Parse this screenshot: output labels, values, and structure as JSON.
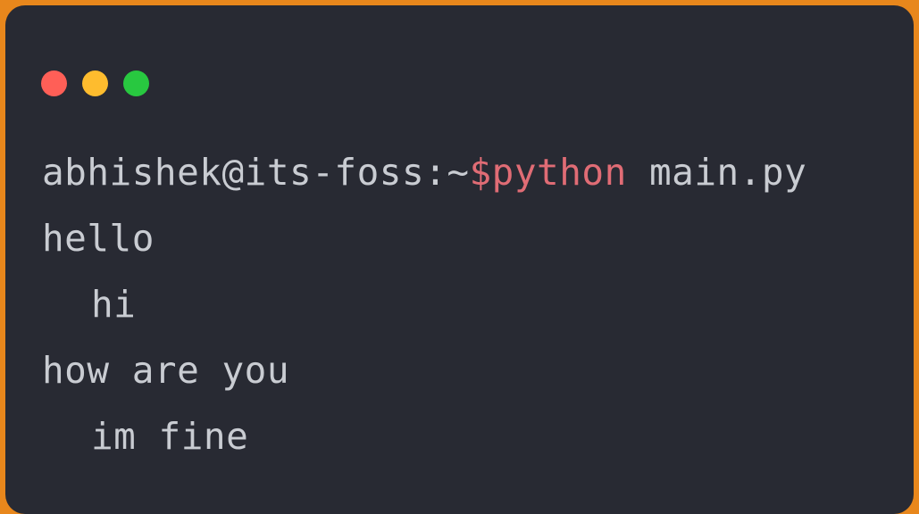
{
  "window": {
    "controls": [
      {
        "name": "close",
        "color": "#ff5f57"
      },
      {
        "name": "minimize",
        "color": "#febc2e"
      },
      {
        "name": "maximize",
        "color": "#28c840"
      }
    ]
  },
  "terminal": {
    "prompt": "abhishek@its-foss:~",
    "command_keyword": "$python",
    "command_args": " main.py",
    "output_lines": [
      "hello",
      "hi",
      "how are you",
      "im fine"
    ]
  },
  "colors": {
    "border": "#e8871c",
    "background": "#282a33",
    "text": "#c9ccd2",
    "keyword": "#e06c75"
  }
}
